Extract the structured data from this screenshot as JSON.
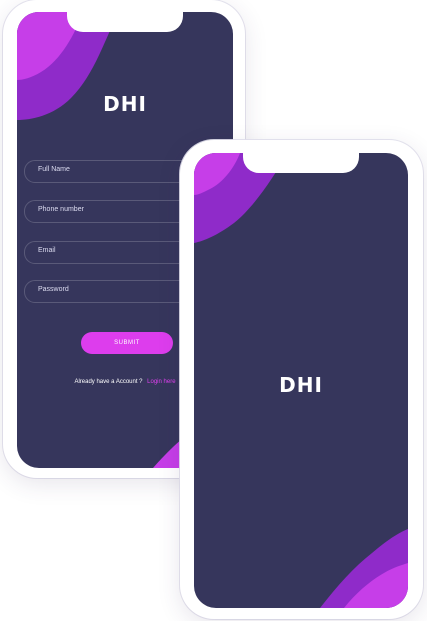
{
  "brand": {
    "logo_text": "DHI"
  },
  "signup_screen": {
    "fields": [
      {
        "label": "Full Name"
      },
      {
        "label": "Phone number"
      },
      {
        "label": "Email"
      },
      {
        "label": "Password"
      }
    ],
    "submit_label": "SUBMIT",
    "account_prompt": "Already have a Account ?",
    "login_link": "Login here"
  },
  "splash_screen": {
    "logo_text": "DHI"
  },
  "colors": {
    "background": "#36365c",
    "accent": "#dd3ded",
    "accent_dark": "#8f2bc9",
    "frame": "#ffffff"
  }
}
